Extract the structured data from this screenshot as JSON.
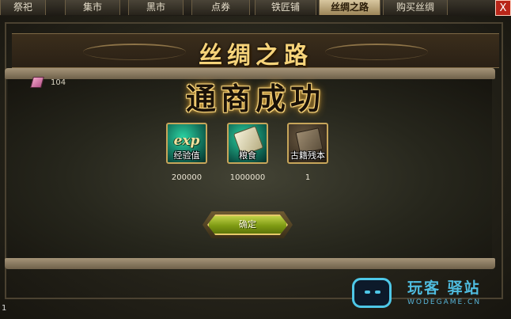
{
  "tabs": [
    {
      "label": "祭祀",
      "active": false
    },
    {
      "label": "集市",
      "active": false
    },
    {
      "label": "黑市",
      "active": false
    },
    {
      "label": "点券",
      "active": false
    },
    {
      "label": "铁匠铺",
      "active": false
    },
    {
      "label": "丝绸之路",
      "active": true
    },
    {
      "label": "购买丝绸",
      "active": false
    }
  ],
  "close_label": "X",
  "panel_title": "丝绸之路",
  "silk_count": "104",
  "success_title": "通商成功",
  "rewards": [
    {
      "icon": "exp-icon",
      "glyph": "exp",
      "caption": "经验值",
      "value": "200000"
    },
    {
      "icon": "grain-icon",
      "caption": "粮食",
      "value": "1000000"
    },
    {
      "icon": "ancient-book-icon",
      "caption": "古籍残本",
      "value": "1"
    }
  ],
  "confirm_label": "确定",
  "status_number": "1",
  "watermark": {
    "text": "玩客 驿站",
    "url": "WODEGAME.CN"
  },
  "colors": {
    "title_gold": "#f6d37a",
    "button_green": "#7f9b14",
    "close_red": "#b8261a",
    "watermark_blue": "#4fbde0"
  }
}
